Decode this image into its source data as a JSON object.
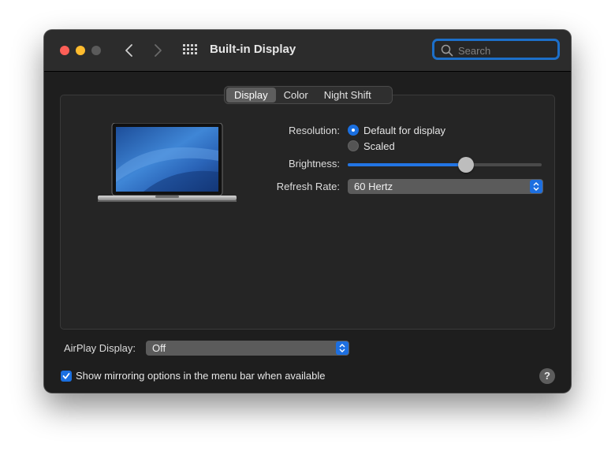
{
  "window": {
    "title": "Built-in Display",
    "search_placeholder": "Search"
  },
  "tabs": [
    {
      "label": "Display",
      "active": true
    },
    {
      "label": "Color",
      "active": false
    },
    {
      "label": "Night Shift",
      "active": false
    }
  ],
  "resolution": {
    "label": "Resolution:",
    "options": [
      {
        "label": "Default for display",
        "selected": true
      },
      {
        "label": "Scaled",
        "selected": false
      }
    ]
  },
  "brightness": {
    "label": "Brightness:",
    "value_percent": 61
  },
  "refresh_rate": {
    "label": "Refresh Rate:",
    "value": "60 Hertz"
  },
  "airplay": {
    "label": "AirPlay Display:",
    "value": "Off"
  },
  "mirroring": {
    "label": "Show mirroring options in the menu bar when available",
    "checked": true
  },
  "help": {
    "label": "?"
  },
  "colors": {
    "accent": "#1a6fe0",
    "window_bg": "#1e1e1e",
    "close": "#fe5f57",
    "minimize": "#febc2e"
  }
}
